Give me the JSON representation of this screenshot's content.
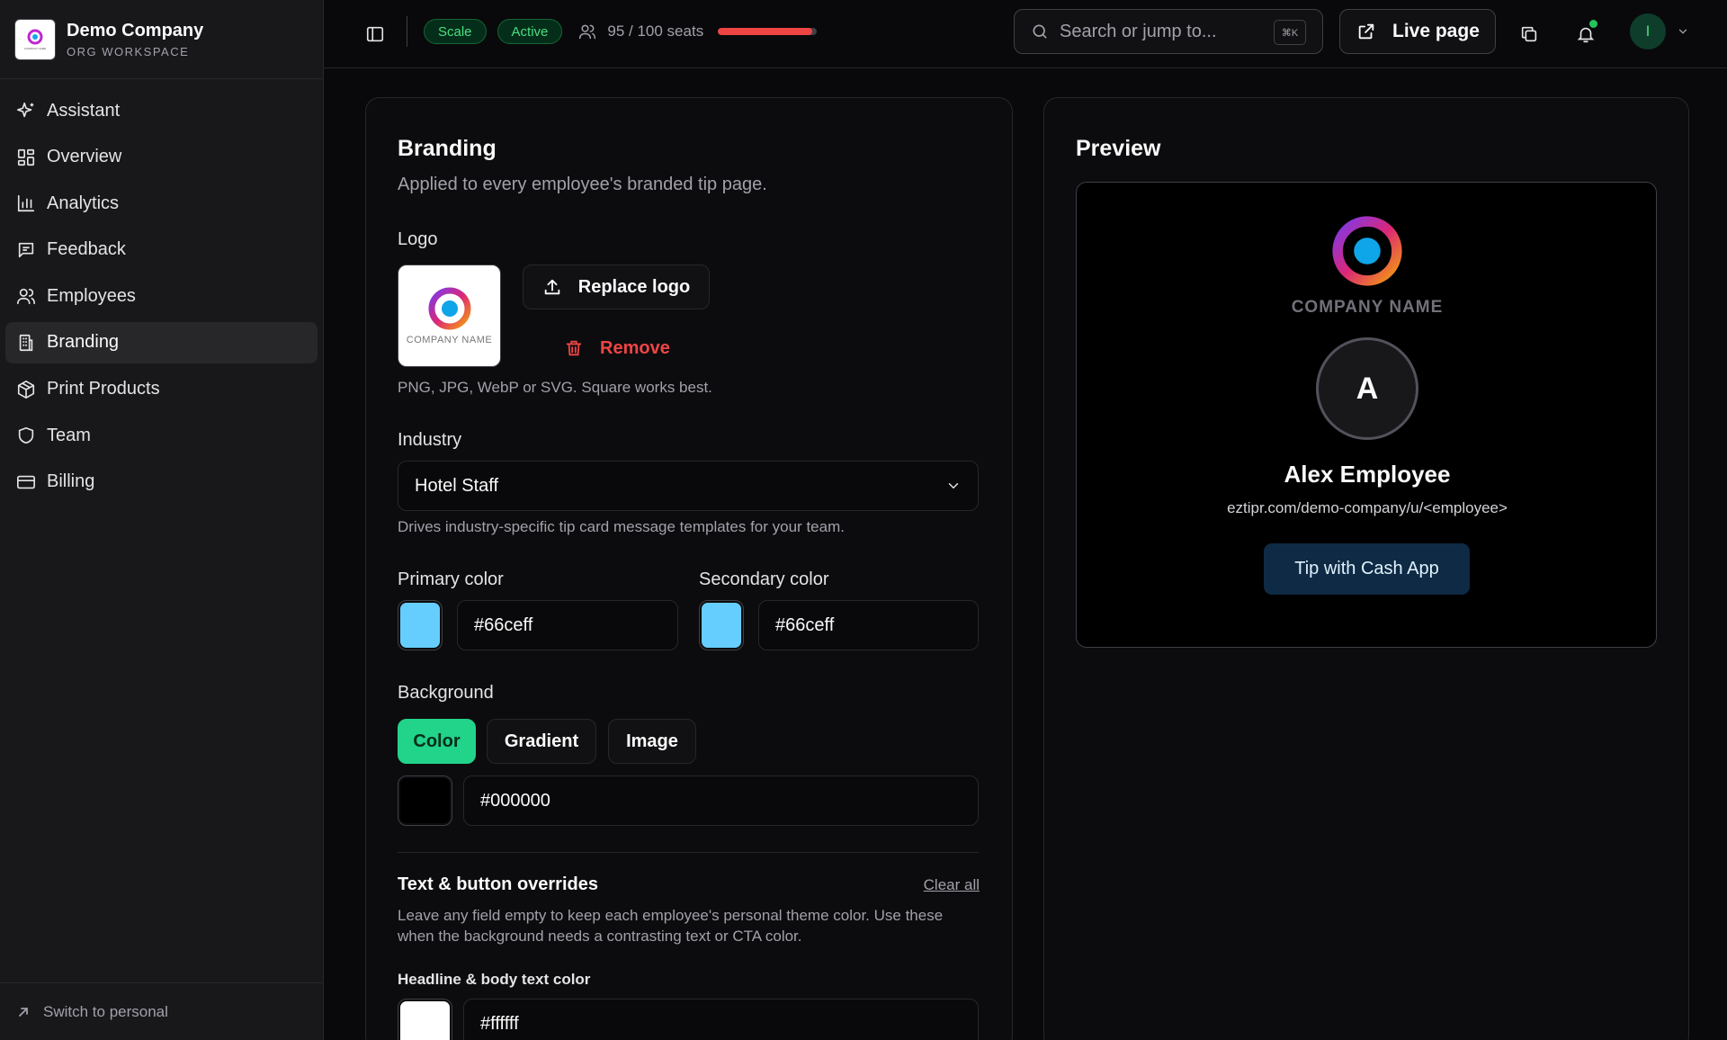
{
  "org": {
    "name": "Demo Company",
    "subtitle": "ORG WORKSPACE",
    "logo_text": "COMPANY NAME"
  },
  "sidebar": {
    "items": [
      {
        "label": "Assistant",
        "icon": "sparkle-icon"
      },
      {
        "label": "Overview",
        "icon": "dashboard-icon"
      },
      {
        "label": "Analytics",
        "icon": "bar-chart-icon"
      },
      {
        "label": "Feedback",
        "icon": "message-icon"
      },
      {
        "label": "Employees",
        "icon": "users-icon"
      },
      {
        "label": "Branding",
        "icon": "building-icon",
        "active": true
      },
      {
        "label": "Print Products",
        "icon": "package-icon"
      },
      {
        "label": "Team",
        "icon": "shield-icon"
      },
      {
        "label": "Billing",
        "icon": "credit-card-icon"
      }
    ],
    "switch_label": "Switch to personal"
  },
  "topbar": {
    "plan_badge": "Scale",
    "status_badge": "Active",
    "seats_label": "95 / 100 seats",
    "seats_used_fraction": 0.95,
    "search_placeholder": "Search or jump to...",
    "search_shortcut": "⌘K",
    "live_page_label": "Live page",
    "avatar_initial": "I"
  },
  "branding": {
    "title": "Branding",
    "subtitle": "Applied to every employee's branded tip page.",
    "logo_label": "Logo",
    "replace_logo_label": "Replace logo",
    "remove_label": "Remove",
    "logo_hint": "PNG, JPG, WebP or SVG. Square works best.",
    "industry_label": "Industry",
    "industry_value": "Hotel Staff",
    "industry_hint": "Drives industry-specific tip card message templates for your team.",
    "primary_color_label": "Primary color",
    "primary_color_value": "#66ceff",
    "secondary_color_label": "Secondary color",
    "secondary_color_value": "#66ceff",
    "background_label": "Background",
    "background_tabs": [
      "Color",
      "Gradient",
      "Image"
    ],
    "background_active": "Color",
    "background_color_value": "#000000",
    "overrides_title": "Text & button overrides",
    "clear_all_label": "Clear all",
    "overrides_hint": "Leave any field empty to keep each employee's personal theme color. Use these when the background needs a contrasting text or CTA color.",
    "headline_color_label": "Headline & body text color",
    "headline_color_value": "#ffffff"
  },
  "preview": {
    "title": "Preview",
    "company_name": "COMPANY NAME",
    "avatar_initial": "A",
    "employee_name": "Alex Employee",
    "url": "eztipr.com/demo-company/u/<employee>",
    "cta_label": "Tip with Cash App"
  },
  "colors": {
    "accent_green": "#22d38a",
    "danger": "#ef4444",
    "primary_swatch": "#66ceff",
    "cta_background": "#0f2a44"
  }
}
